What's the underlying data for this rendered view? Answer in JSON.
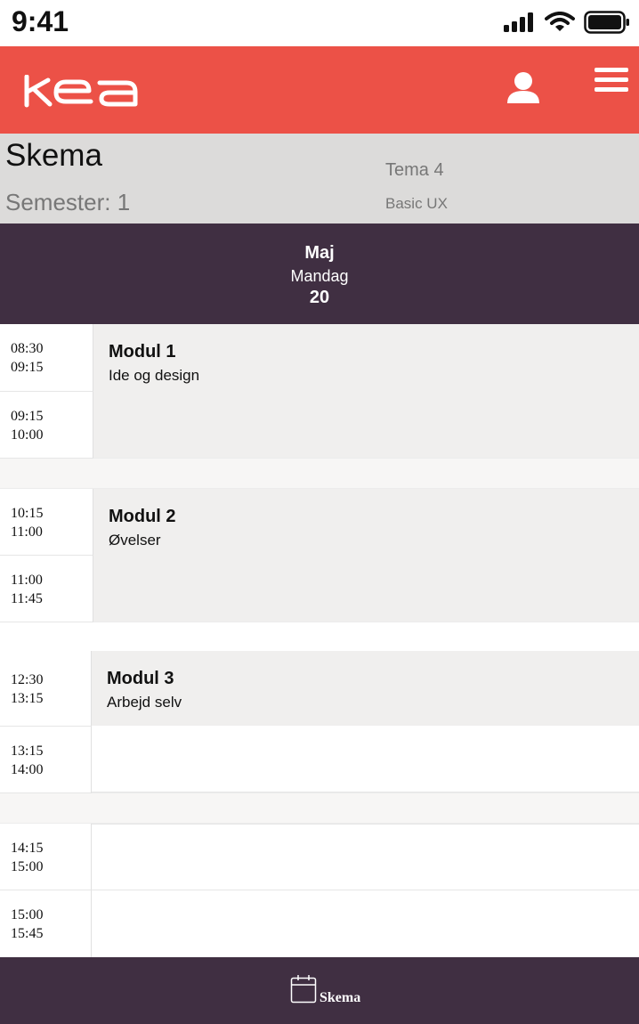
{
  "status_bar": {
    "time": "9:41"
  },
  "header": {
    "logo_text": "kea",
    "brand_color": "#ec5147",
    "icons": [
      "user-icon",
      "menu-icon"
    ]
  },
  "page": {
    "title": "Skema",
    "semester": "Semester: 1",
    "theme": "Tema 4",
    "theme_subtitle": "Basic UX"
  },
  "date": {
    "month": "Maj",
    "weekday": "Mandag",
    "day": "20"
  },
  "time_slots": [
    {
      "start": "08:30",
      "end": "09:15"
    },
    {
      "start": "09:15",
      "end": "10:00"
    },
    {
      "start": "10:15",
      "end": "11:00"
    },
    {
      "start": "11:00",
      "end": "11:45"
    },
    {
      "start": "12:30",
      "end": "13:15"
    },
    {
      "start": "13:15",
      "end": "14:00"
    },
    {
      "start": "14:15",
      "end": "15:00"
    },
    {
      "start": "15:00",
      "end": "15:45"
    }
  ],
  "modules": [
    {
      "title": "Modul 1",
      "subtitle": "Ide og design"
    },
    {
      "title": "Modul 2",
      "subtitle": "Øvelser"
    },
    {
      "title": "Modul 3",
      "subtitle": "Arbejd selv"
    }
  ],
  "bottom_nav": {
    "label": "Skema",
    "icon": "calendar-icon",
    "color": "#402f42"
  }
}
